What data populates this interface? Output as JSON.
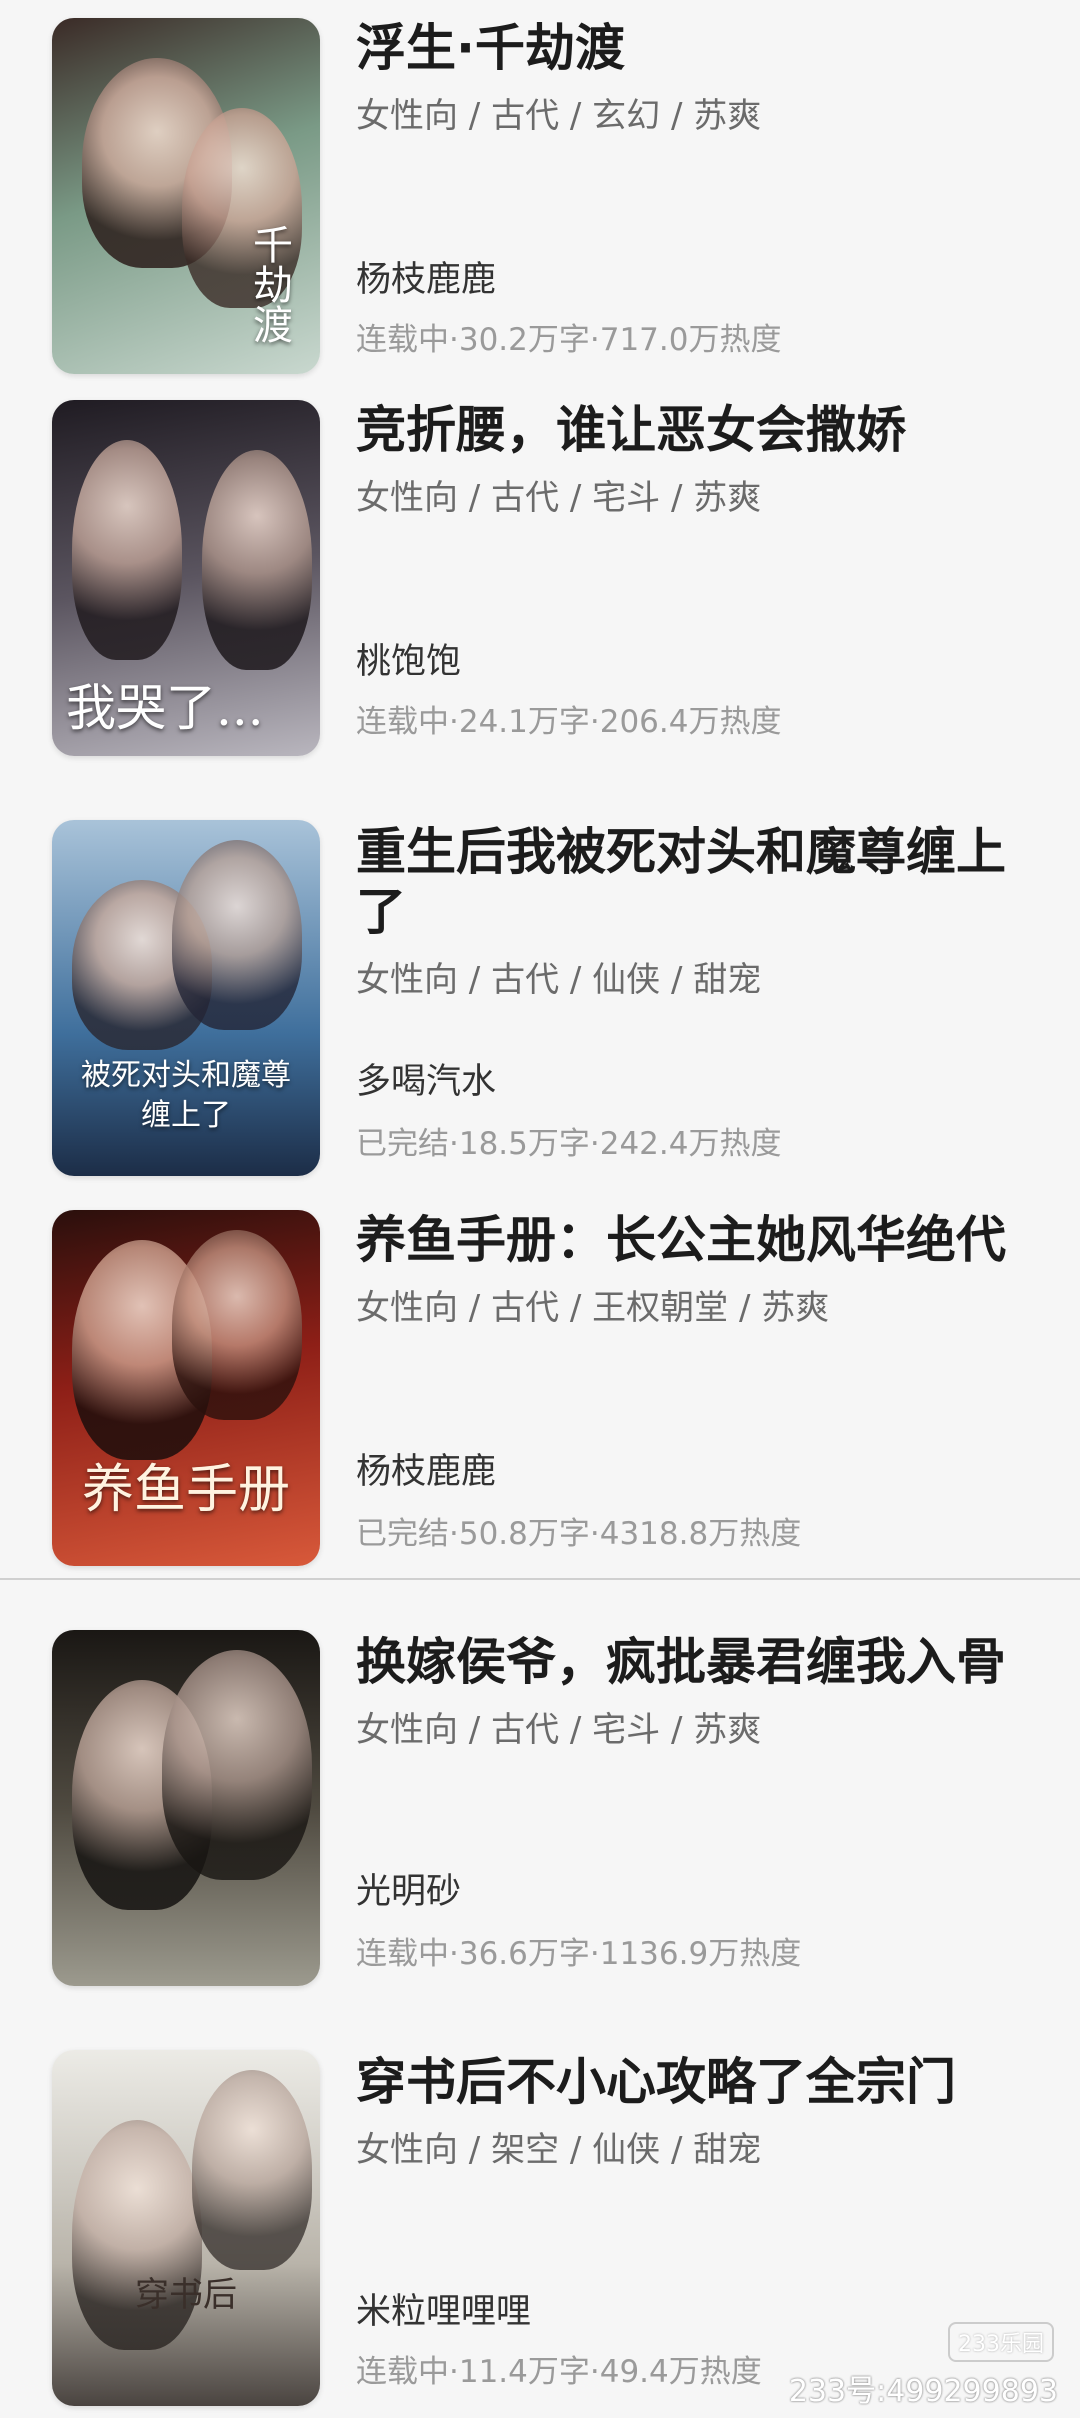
{
  "books": [
    {
      "title": "浮生·千劫渡",
      "tags": "女性向 / 古代 / 玄幻 / 苏爽",
      "author": "杨枝鹿鹿",
      "stats": "连载中·30.2万字·717.0万热度",
      "cover_text": "千劫渡",
      "cover_colors": [
        "#c9d8cf",
        "#7a9a86",
        "#3a2a26"
      ]
    },
    {
      "title": "竞折腰，谁让恶女会撒娇",
      "tags": "女性向 / 古代 / 宅斗 / 苏爽",
      "author": "桃饱饱",
      "stats": "连载中·24.1万字·206.4万热度",
      "cover_text": "我哭了...",
      "cover_colors": [
        "#b9b6be",
        "#5b5560",
        "#1f1b22"
      ]
    },
    {
      "title": "重生后我被死对头和魔尊缠上了",
      "tags": "女性向 / 古代 / 仙侠 / 甜宠",
      "author": "多喝汽水",
      "stats": "已完结·18.5万字·242.4万热度",
      "cover_text": "被死对头和魔尊缠上了",
      "cover_colors": [
        "#a9c3d9",
        "#3f6f9c",
        "#1c2d47"
      ]
    },
    {
      "title": "养鱼手册：长公主她风华绝代",
      "tags": "女性向 / 古代 / 王权朝堂 / 苏爽",
      "author": "杨枝鹿鹿",
      "stats": "已完结·50.8万字·4318.8万热度",
      "cover_text": "养鱼手册",
      "cover_colors": [
        "#d8593a",
        "#8e1f17",
        "#2a0f0c"
      ]
    },
    {
      "title": "换嫁侯爷，疯批暴君缠我入骨",
      "tags": "女性向 / 古代 / 宅斗 / 苏爽",
      "author": "光明砂",
      "stats": "连载中·36.6万字·1136.9万热度",
      "cover_text": "",
      "cover_colors": [
        "#9c9a8e",
        "#4f4a40",
        "#1a1714"
      ]
    },
    {
      "title": "穿书后不小心攻略了全宗门",
      "tags": "女性向 / 架空 / 仙侠 / 甜宠",
      "author": "米粒哩哩哩",
      "stats": "连载中·11.4万字·49.4万热度",
      "cover_text": "穿书后",
      "cover_colors": [
        "#ecebe6",
        "#b9b4aa",
        "#4a4440"
      ]
    }
  ],
  "watermark": "233号:499299893",
  "watermark_logo": "233乐园"
}
